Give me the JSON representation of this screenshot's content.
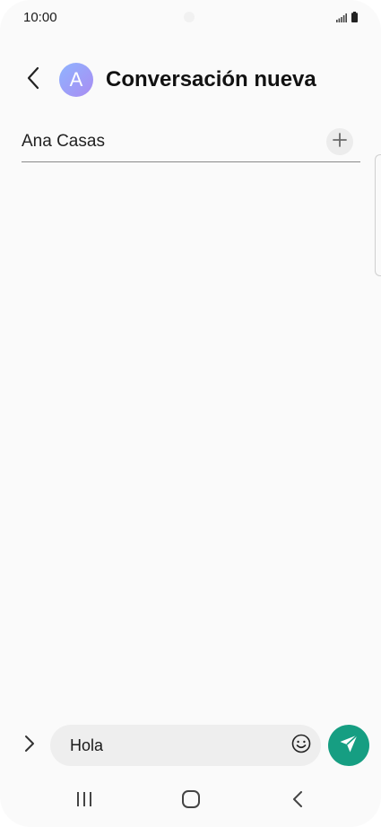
{
  "status_bar": {
    "time": "10:00"
  },
  "header": {
    "avatar_letter": "A",
    "title": "Conversación nueva"
  },
  "recipient": {
    "name": "Ana Casas"
  },
  "composer": {
    "message": "Hola"
  },
  "colors": {
    "send_button": "#169e82",
    "avatar_gradient_start": "#8fb4ff",
    "avatar_gradient_end": "#a98cf2"
  },
  "icons": {
    "back": "back-arrow-icon",
    "add": "plus-icon",
    "expand": "chevron-right-icon",
    "emoji": "smiley-icon",
    "send": "paper-plane-icon",
    "nav_recents": "recents-icon",
    "nav_home": "home-icon",
    "nav_back": "nav-back-icon"
  }
}
